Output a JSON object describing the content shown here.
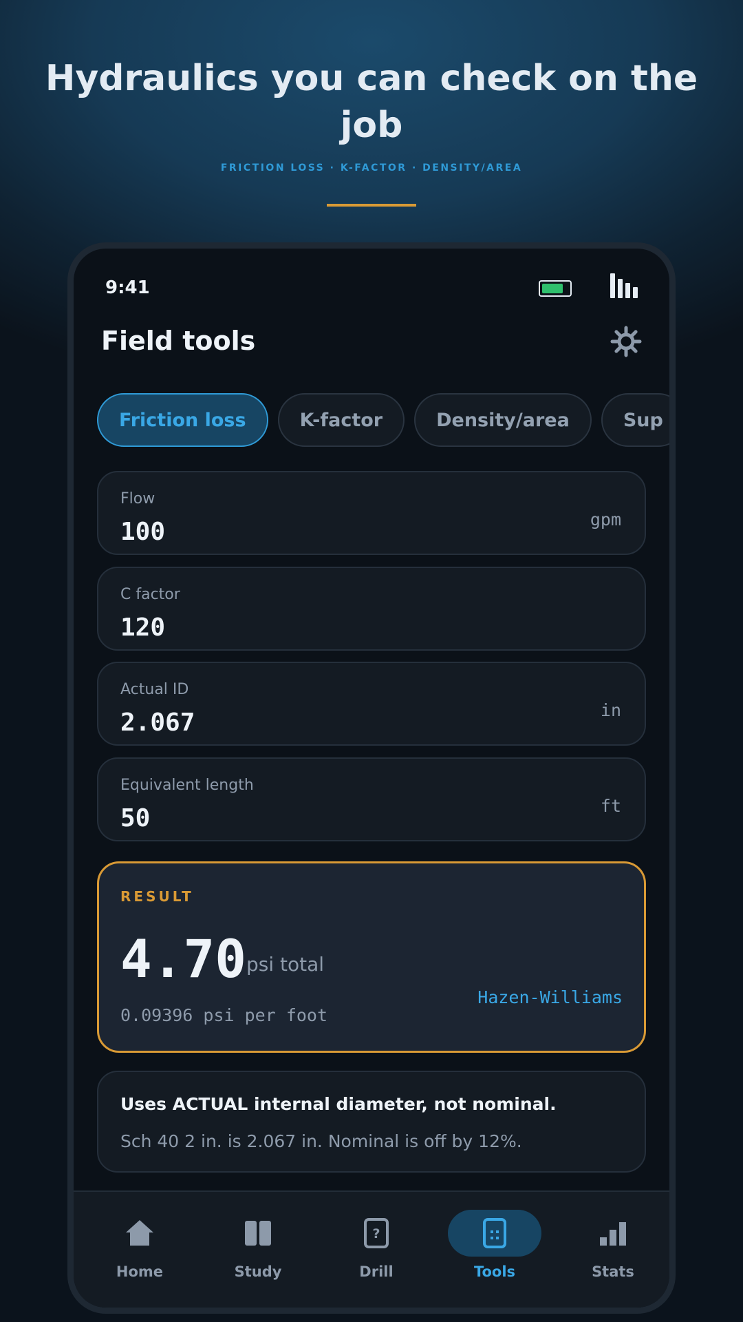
{
  "hero": {
    "title": "Hydraulics you can check on the job",
    "subtitle": "FRICTION LOSS · K-FACTOR · DENSITY/AREA"
  },
  "status_bar": {
    "time": "9:41"
  },
  "app_bar": {
    "title": "Field tools",
    "settings_icon": "gear-icon"
  },
  "tool_tabs": [
    {
      "label": "Friction loss",
      "active": true
    },
    {
      "label": "K-factor",
      "active": false
    },
    {
      "label": "Density/area",
      "active": false
    },
    {
      "label": "Sup",
      "active": false
    }
  ],
  "inputs": [
    {
      "label": "Flow",
      "value": "100",
      "unit": "gpm"
    },
    {
      "label": "C factor",
      "value": "120",
      "unit": ""
    },
    {
      "label": "Actual ID",
      "value": "2.067",
      "unit": "in"
    },
    {
      "label": "Equivalent length",
      "value": "50",
      "unit": "ft"
    }
  ],
  "result": {
    "label": "RESULT",
    "value": "4.70",
    "unit": "psi total",
    "per_foot": "0.09396 psi per foot",
    "method": "Hazen-Williams"
  },
  "note": {
    "heading": "Uses ACTUAL internal diameter, not nominal.",
    "body": "Sch 40 2 in. is 2.067 in. Nominal is off by 12%."
  },
  "bottom_nav": [
    {
      "label": "Home",
      "icon": "home-icon",
      "active": false
    },
    {
      "label": "Study",
      "icon": "book-icon",
      "active": false
    },
    {
      "label": "Drill",
      "icon": "question-card-icon",
      "active": false
    },
    {
      "label": "Tools",
      "icon": "calculator-icon",
      "active": true
    },
    {
      "label": "Stats",
      "icon": "bar-chart-icon",
      "active": false
    }
  ],
  "colors": {
    "accent_blue": "#3aa8e6",
    "accent_gold": "#d99a35",
    "background": "#0b1118",
    "battery_green": "#2fbf6d"
  }
}
